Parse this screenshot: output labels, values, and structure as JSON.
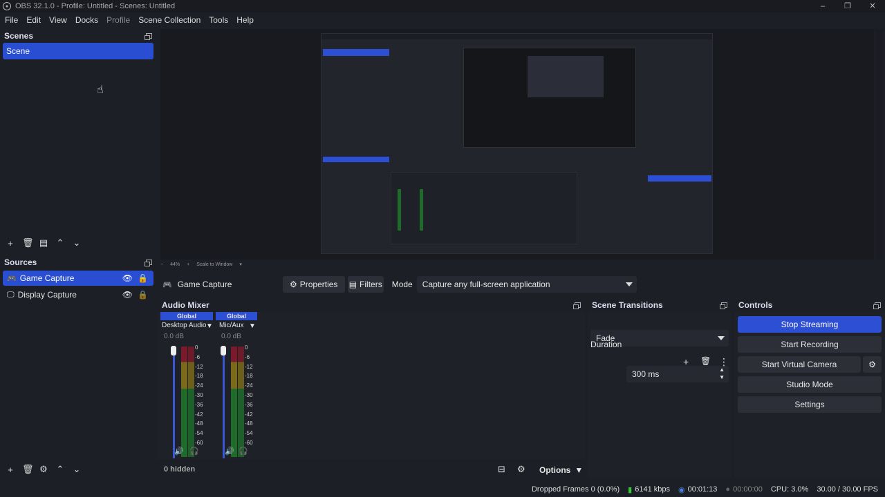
{
  "window": {
    "title": "OBS 32.1.0 - Profile: Untitled - Scenes: Untitled",
    "controls": [
      "–",
      "❐",
      "✕"
    ]
  },
  "menu": [
    "File",
    "Edit",
    "View",
    "Docks",
    "Profile",
    "Scene Collection",
    "Tools",
    "Help"
  ],
  "scenes": {
    "title": "Scenes",
    "items": [
      "Scene"
    ]
  },
  "sources": {
    "title": "Sources",
    "items": [
      {
        "label": "Game Capture",
        "icon": "gamepad-icon"
      },
      {
        "label": "Display Capture",
        "icon": "monitor-icon"
      }
    ]
  },
  "preview_bar": {
    "zoom": "44%",
    "scale": "Scale to Window"
  },
  "context_bar": {
    "source": "Game Capture",
    "properties": "Properties",
    "filters": "Filters",
    "mode_label": "Mode",
    "mode_value": "Capture any full-screen application"
  },
  "audio_mixer": {
    "title": "Audio Mixer",
    "channels": [
      {
        "tag": "Global",
        "name": "Desktop Audio",
        "db": "0.0 dB"
      },
      {
        "tag": "Global",
        "name": "Mic/Aux",
        "db": "0.0 dB"
      }
    ],
    "ticks": [
      "0",
      "-6",
      "-12",
      "-18",
      "-24",
      "-30",
      "-36",
      "-42",
      "-48",
      "-54",
      "-60"
    ],
    "hidden": "0 hidden",
    "options": "Options"
  },
  "transitions": {
    "title": "Scene Transitions",
    "value": "Fade",
    "duration_label": "Duration",
    "duration": "300 ms"
  },
  "controls": {
    "title": "Controls",
    "buttons": [
      "Stop Streaming",
      "Start Recording",
      "Start Virtual Camera",
      "Studio Mode",
      "Settings"
    ]
  },
  "status": {
    "dropped": "Dropped Frames 0 (0.0%)",
    "kbps": "6141 kbps",
    "stream_time": "00:01:13",
    "rec_time": "00:00:00",
    "cpu": "CPU: 3.0%",
    "fps": "30.00 / 30.00 FPS"
  },
  "colors": {
    "accent": "#2d4fd4",
    "background": "#1d1f26"
  }
}
